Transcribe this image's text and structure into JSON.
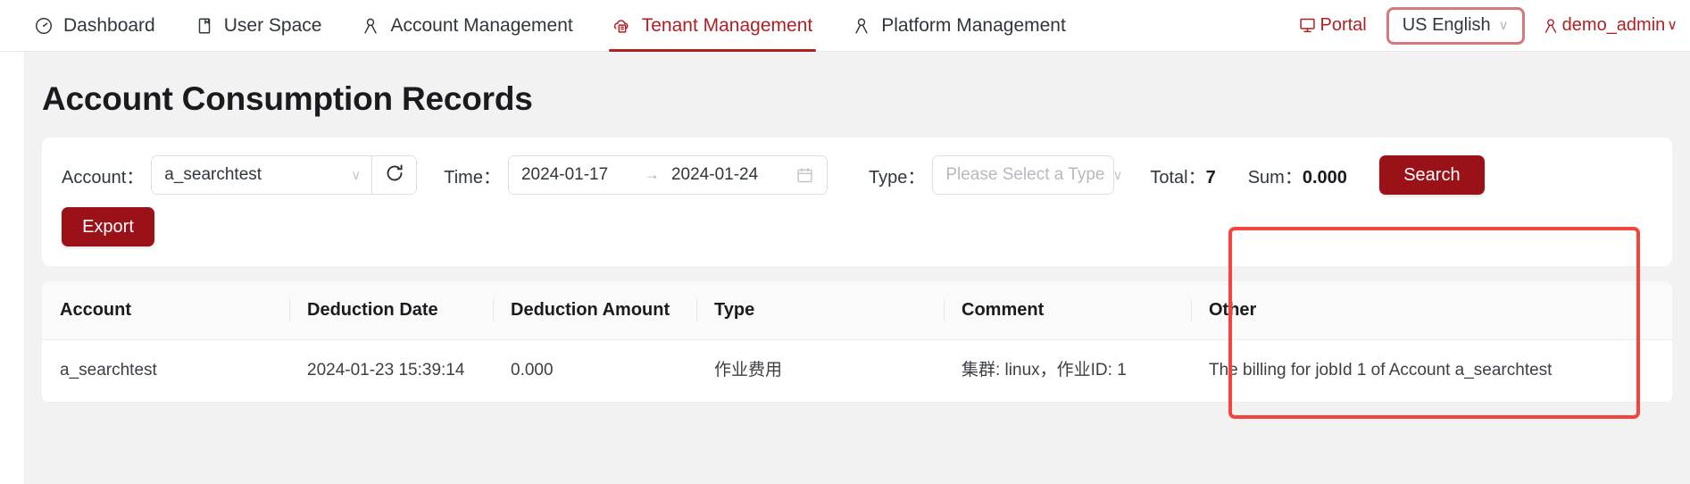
{
  "navbar": {
    "items": [
      {
        "label": "Dashboard",
        "icon": "gauge-icon",
        "active": false
      },
      {
        "label": "User Space",
        "icon": "document-icon",
        "active": false
      },
      {
        "label": "Account Management",
        "icon": "person-icon",
        "active": false
      },
      {
        "label": "Tenant Management",
        "icon": "cloud-building-icon",
        "active": true
      },
      {
        "label": "Platform Management",
        "icon": "person-icon",
        "active": false
      }
    ],
    "portal": {
      "label": "Portal",
      "icon": "monitor-icon"
    },
    "language": {
      "value": "US English",
      "caret": "∨"
    },
    "user": {
      "name": "demo_admin",
      "icon": "person-icon",
      "caret": "∨"
    }
  },
  "page": {
    "title": "Account Consumption Records"
  },
  "filters": {
    "account_label": "Account：",
    "account_value": "a_searchtest",
    "refresh_icon": "refresh-icon",
    "time_label": "Time：",
    "date_start": "2024-01-17",
    "date_arrow": "→",
    "date_end": "2024-01-24",
    "calendar_icon": "calendar-icon",
    "type_label": "Type：",
    "type_placeholder": "Please Select a Type",
    "total_label": "Total：",
    "total_value": "7",
    "sum_label": "Sum：",
    "sum_value": "0.000",
    "search_label": "Search",
    "export_label": "Export"
  },
  "table": {
    "columns": [
      "Account",
      "Deduction Date",
      "Deduction Amount",
      "Type",
      "Comment",
      "Other"
    ],
    "rows": [
      {
        "account": "a_searchtest",
        "deduction_date": "2024-01-23 15:39:14",
        "deduction_amount": "0.000",
        "type": "作业费用",
        "comment": "集群: linux，作业ID: 1",
        "other": "The billing for jobId 1 of Account a_searchtest"
      }
    ]
  },
  "annotation": {
    "highlight_color": "#f4453c",
    "target": "Other"
  },
  "colors": {
    "brand_red": "#b01f24",
    "button_red": "#9b1118",
    "page_bg": "#f2f2f3",
    "annotation_red": "#f4453c"
  }
}
